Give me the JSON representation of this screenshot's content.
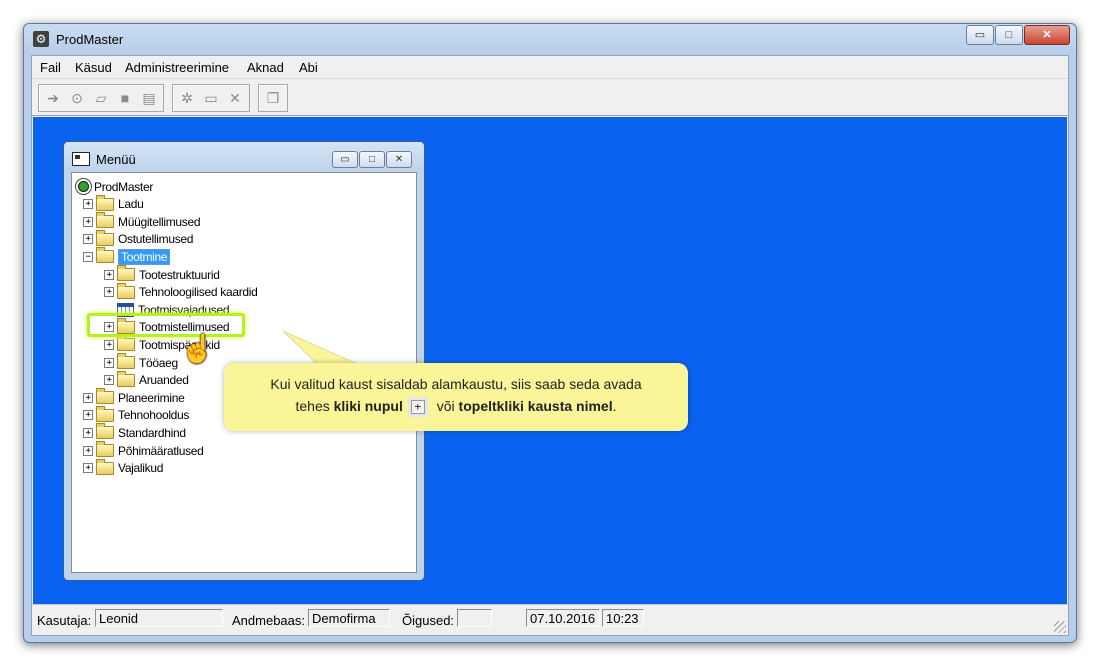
{
  "window": {
    "title": "ProdMaster",
    "minimize": "▭",
    "maximize": "□",
    "close": "✕"
  },
  "menubar": [
    {
      "label": "Fail"
    },
    {
      "label": "Käsud"
    },
    {
      "label": "Administreerimine"
    },
    {
      "label": "Aknad"
    },
    {
      "label": "Abi"
    }
  ],
  "toolbar": {
    "group1_icons": [
      "new-record-icon",
      "binoculars-icon",
      "eraser-icon",
      "stop-icon",
      "document-icon"
    ],
    "group2_icons": [
      "new-folder-icon",
      "folder-icon",
      "delete-icon"
    ],
    "group3_icons": [
      "copy-icon"
    ]
  },
  "menu_window": {
    "title": "Menüü",
    "tree": [
      {
        "label": "ProdMaster",
        "level": 0,
        "type": "root"
      },
      {
        "label": "Ladu",
        "level": 1,
        "expander": "+"
      },
      {
        "label": "Müügitellimused",
        "level": 1,
        "expander": "+"
      },
      {
        "label": "Ostutellimused",
        "level": 1,
        "expander": "+"
      },
      {
        "label": "Tootmine",
        "level": 1,
        "expander": "−",
        "selected": true
      },
      {
        "label": "Tootestruktuurid",
        "level": 2,
        "expander": "+"
      },
      {
        "label": "Tehnoloogilised kaardid",
        "level": 2,
        "expander": "+"
      },
      {
        "label": "Tootmisvajadused",
        "level": 2,
        "type": "grid"
      },
      {
        "label": "Tootmistellimused",
        "level": 2,
        "expander": "+",
        "highlighted": true
      },
      {
        "label": "Tootmispäevikid",
        "level": 2,
        "expander": "+"
      },
      {
        "label": "Tööaeg",
        "level": 2,
        "expander": "+"
      },
      {
        "label": "Aruanded",
        "level": 2,
        "expander": "+"
      },
      {
        "label": "Planeerimine",
        "level": 1,
        "expander": "+"
      },
      {
        "label": "Tehnohooldus",
        "level": 1,
        "expander": "+"
      },
      {
        "label": "Standardhind",
        "level": 1,
        "expander": "+"
      },
      {
        "label": "Põhimääratlused",
        "level": 1,
        "expander": "+"
      },
      {
        "label": "Vajalikud",
        "level": 1,
        "expander": "+"
      }
    ]
  },
  "callout": {
    "line1": "Kui valitud kaust sisaldab alamkaustu, siis saab seda avada",
    "line2_pre": "tehes ",
    "line2_bold1": "kliki nupul",
    "plus": "+",
    "line2_mid": " või ",
    "line2_bold2": "topeltkliki kausta nimel",
    "line2_end": "."
  },
  "statusbar": {
    "user_label": "Kasutaja:",
    "user_value": "Leonid",
    "db_label": "Andmebaas:",
    "db_value": "Demofirma",
    "rights_label": "Õigused:",
    "rights_value": "",
    "date": "07.10.2016",
    "time": "10:23"
  },
  "colors": {
    "mdi_background": "#0a63f0",
    "callout": "#fbf59a",
    "selection": "#3399ff",
    "highlight": "#b7f01f"
  }
}
